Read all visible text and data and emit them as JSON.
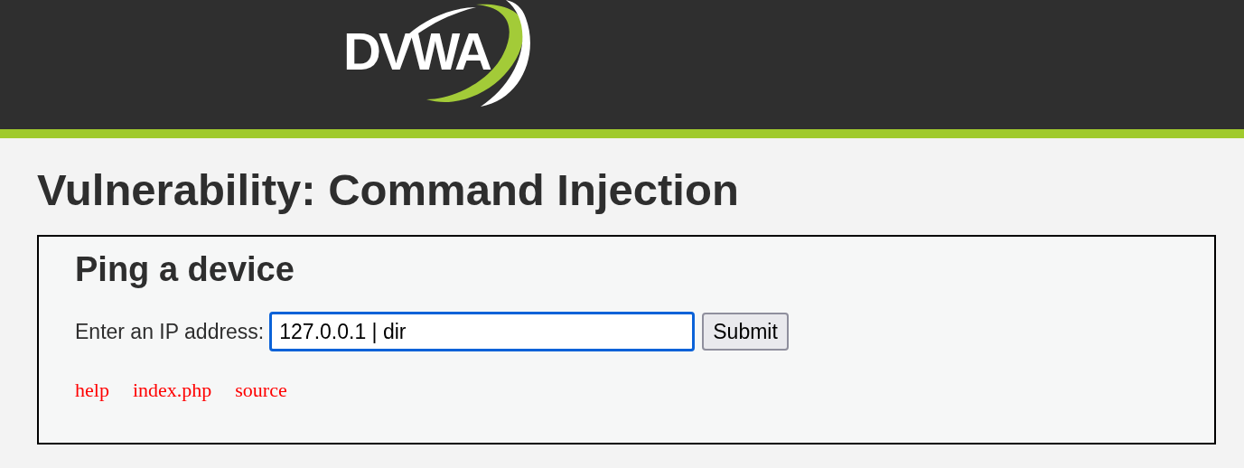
{
  "header": {
    "logo": "DVWA"
  },
  "title": "Vulnerability: Command Injection",
  "panel": {
    "heading": "Ping a device",
    "label": "Enter an IP address:",
    "value": "127.0.0.1 | dir",
    "focused": true,
    "button": "Submit"
  },
  "links": [
    "help",
    "index.php",
    "source"
  ]
}
